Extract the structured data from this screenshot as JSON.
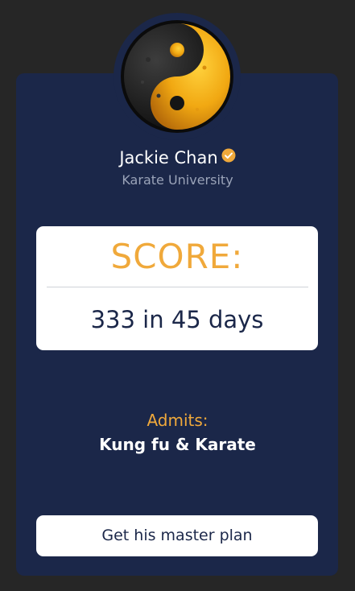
{
  "profile": {
    "name": "Jackie Chan",
    "subtitle": "Karate University",
    "verified": true,
    "avatar_icon": "yin-yang-icon",
    "verified_icon": "verified-check-icon"
  },
  "score": {
    "label": "SCORE:",
    "value": "333 in 45 days"
  },
  "admits": {
    "label": "Admits:",
    "value": "Kung fu & Karate"
  },
  "cta": {
    "label": "Get his master plan"
  },
  "colors": {
    "background": "#262626",
    "card": "#1b2749",
    "accent": "#f0a93b",
    "text_light": "#ffffff",
    "text_muted": "#9aa3b8"
  }
}
